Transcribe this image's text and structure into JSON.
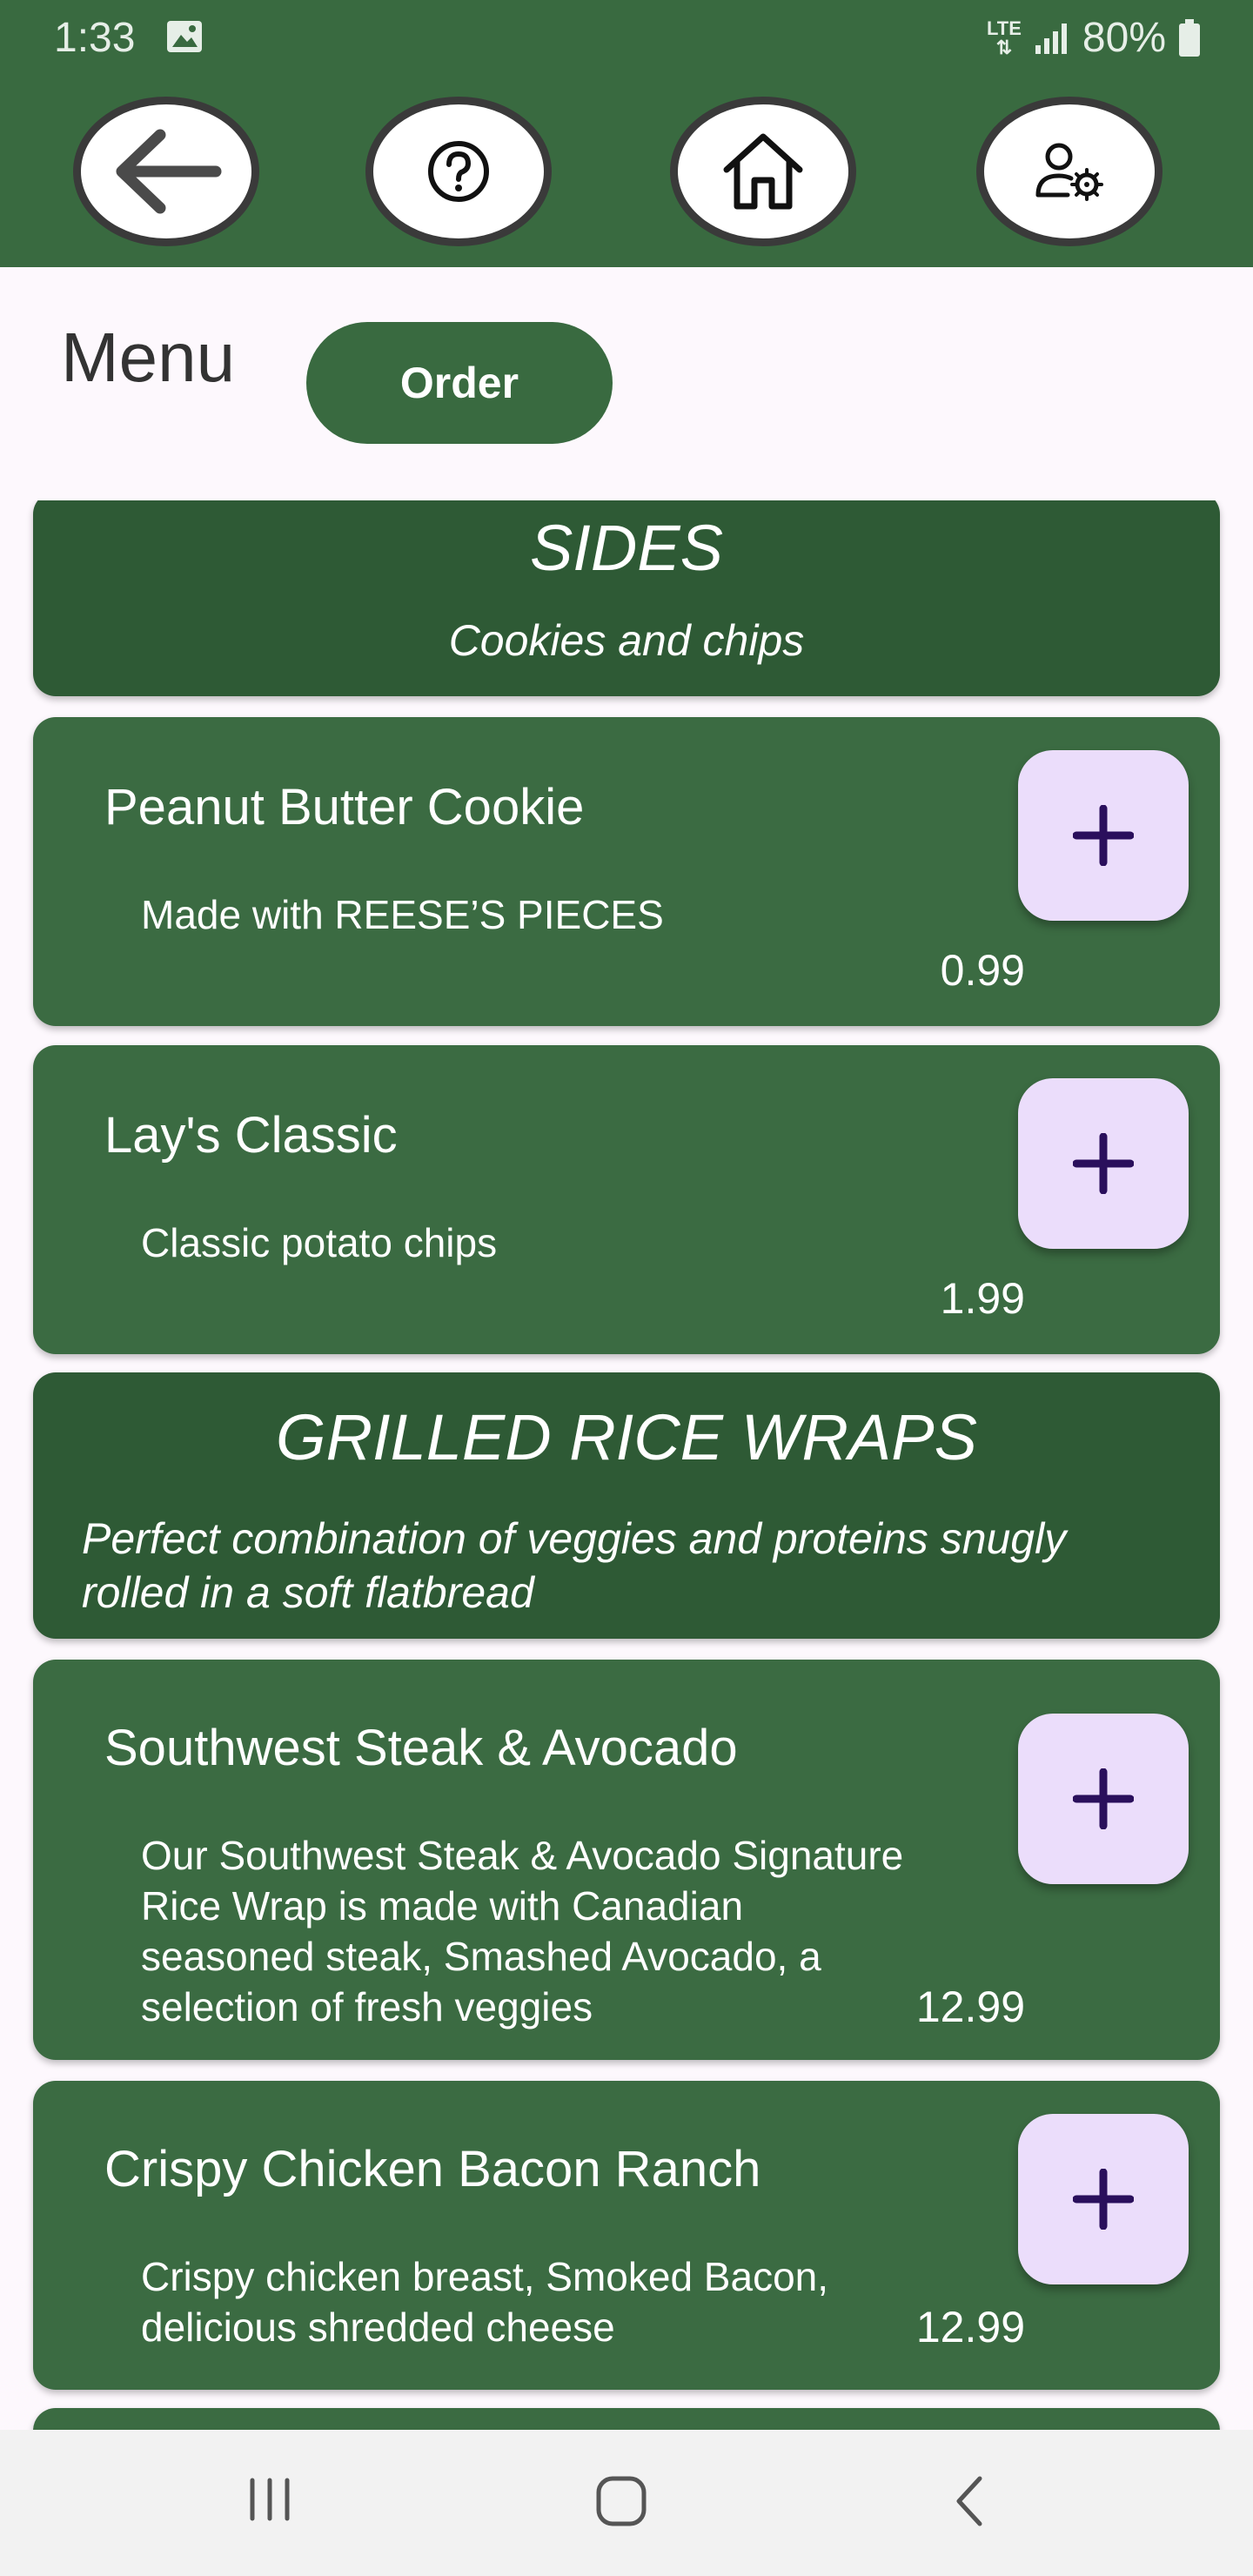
{
  "status_bar": {
    "time": "1:33",
    "network": "LTE",
    "battery": "80%"
  },
  "toolbar": {
    "buttons": [
      {
        "icon": "back-arrow-icon"
      },
      {
        "icon": "help-icon"
      },
      {
        "icon": "home-icon"
      },
      {
        "icon": "user-settings-icon"
      }
    ]
  },
  "header": {
    "title": "Menu",
    "order_label": "Order"
  },
  "menu": {
    "sides": {
      "title": "SIDES",
      "description": "Cookies and chips"
    },
    "items": [
      {
        "name": "Peanut Butter Cookie",
        "description": "Made with REESE’S PIECES",
        "price": "0.99"
      },
      {
        "name": "Lay's Classic",
        "description": "Classic potato chips",
        "price": "1.99"
      }
    ],
    "wraps": {
      "title": "GRILLED RICE WRAPS",
      "description": "Perfect combination of veggies and proteins snugly rolled in a soft flatbread"
    },
    "wrap_items": [
      {
        "name": "Southwest Steak & Avocado",
        "description": "Our Southwest Steak & Avocado Signature Rice Wrap is made with Canadian seasoned steak, Smashed Avocado, a selection of fresh veggies",
        "price": "12.99"
      },
      {
        "name": "Crispy Chicken Bacon Ranch",
        "description": "Crispy chicken breast, Smoked Bacon, delicious shredded cheese",
        "price": "12.99"
      }
    ]
  },
  "colors": {
    "primary": "#396a40",
    "category": "#2e5a35",
    "add_button": "#ebddfb",
    "plus": "#2a0f5c"
  }
}
